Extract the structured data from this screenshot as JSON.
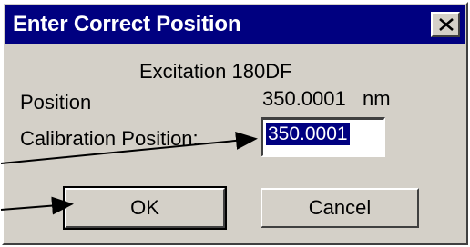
{
  "dialog": {
    "title": "Enter Correct Position",
    "close_icon": "close-icon",
    "heading": "Excitation 180DF",
    "position_label": "Position",
    "position_value": "350.0001",
    "position_unit": "nm",
    "calibration_label": "Calibration Position:",
    "calibration_value": "350.0001",
    "ok_label": "OK",
    "cancel_label": "Cancel"
  },
  "colors": {
    "titlebar": "#000080",
    "window": "#d4d0c8",
    "highlight": "#000080"
  }
}
